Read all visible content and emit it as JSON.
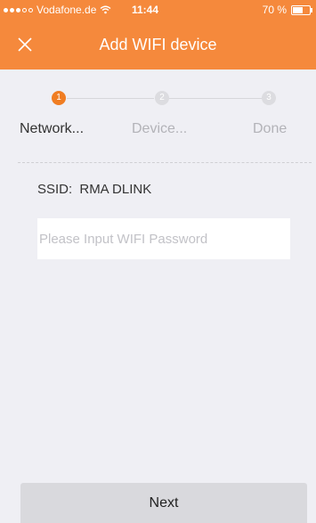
{
  "status_bar": {
    "carrier": "Vodafone.de",
    "time": "11:44",
    "battery_text": "70 %",
    "battery_level": 0.7
  },
  "header": {
    "title": "Add WIFI device",
    "close_icon": "close-icon"
  },
  "steps": [
    {
      "number": "1",
      "label": "Network...",
      "active": true
    },
    {
      "number": "2",
      "label": "Device...",
      "active": false
    },
    {
      "number": "3",
      "label": "Done",
      "active": false
    }
  ],
  "form": {
    "ssid_label": "SSID:",
    "ssid_value": "RMA DLINK",
    "password_value": "",
    "password_placeholder": "Please Input WIFI Password"
  },
  "footer": {
    "next_label": "Next"
  },
  "colors": {
    "accent": "#f5893c",
    "step_active": "#f07d22",
    "step_inactive": "#dcdce0",
    "background": "#efeff4"
  }
}
